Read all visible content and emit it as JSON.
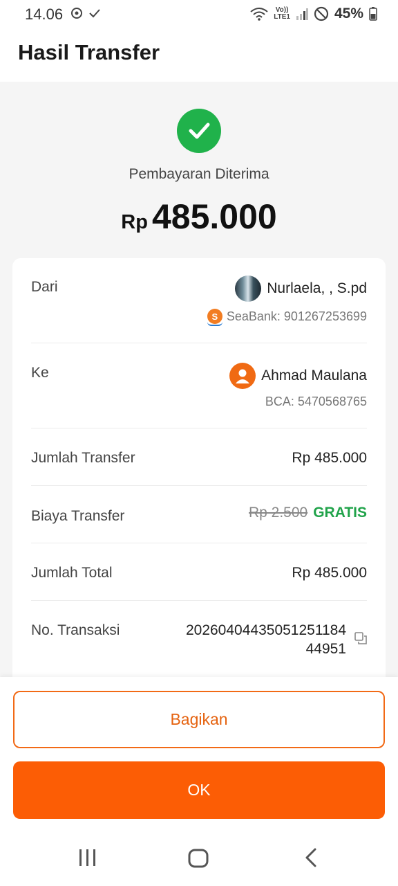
{
  "status_bar": {
    "time": "14.06",
    "lte_top": "Vo))",
    "lte_bottom": "LTE1",
    "battery": "45%"
  },
  "header": {
    "title": "Hasil Transfer"
  },
  "summary": {
    "status": "Pembayaran Diterima",
    "currency": "Rp",
    "amount": "485.000"
  },
  "details": {
    "from": {
      "label": "Dari",
      "name": "Nurlaela, , S.pd",
      "account": "SeaBank: 901267253699",
      "bank_icon_letter": "S"
    },
    "to": {
      "label": "Ke",
      "name": "Ahmad Maulana",
      "account": "BCA: 5470568765"
    },
    "transfer_amount": {
      "label": "Jumlah Transfer",
      "value": "Rp 485.000"
    },
    "transfer_fee": {
      "label": "Biaya Transfer",
      "original": "Rp 2.500",
      "value": "GRATIS"
    },
    "total": {
      "label": "Jumlah Total",
      "value": "Rp 485.000"
    },
    "transaction": {
      "label": "No. Transaksi",
      "line1": "20260404435051251184",
      "line2": "44951"
    }
  },
  "buttons": {
    "share": "Bagikan",
    "ok": "OK"
  },
  "colors": {
    "accent": "#fc5d05",
    "success": "#20b24b",
    "free": "#20a34a"
  },
  "icons": {
    "success": "check-circle-icon",
    "copy": "copy-icon",
    "nav_recent": "recent-apps-icon",
    "nav_home": "home-icon",
    "nav_back": "back-icon"
  }
}
